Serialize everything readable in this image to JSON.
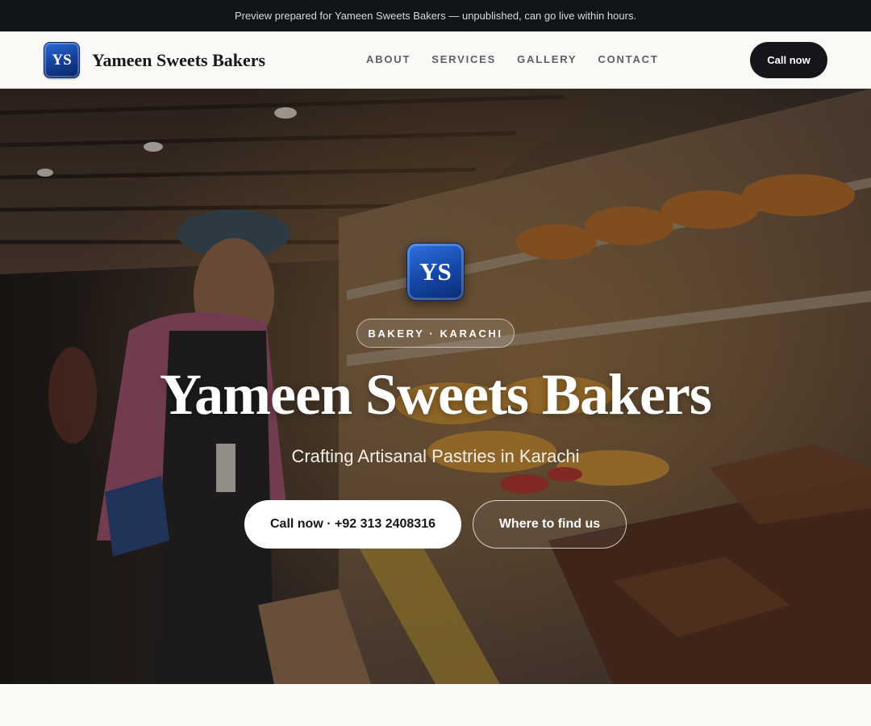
{
  "preview_banner": {
    "text": "Preview prepared for Yameen Sweets Bakers — unpublished, can go live within hours."
  },
  "header": {
    "logo_initials": "YS",
    "brand_name": "Yameen Sweets Bakers",
    "nav": [
      {
        "label": "ABOUT"
      },
      {
        "label": "SERVICES"
      },
      {
        "label": "GALLERY"
      },
      {
        "label": "CONTACT"
      }
    ],
    "call_button_label": "Call now"
  },
  "hero": {
    "background_image": "bakery-counter-photo",
    "logo_initials": "YS",
    "badge": "BAKERY · KARACHI",
    "title": "Yameen Sweets Bakers",
    "subtitle": "Crafting Artisanal Pastries in Karachi",
    "primary_button": "Call now · +92 313 2408316",
    "secondary_button": "Where to find us"
  },
  "colors": {
    "dark": "#111419",
    "logo_blue": "#1446a6",
    "page_background": "#faf9f6",
    "nav_text": "#5a5f68"
  }
}
